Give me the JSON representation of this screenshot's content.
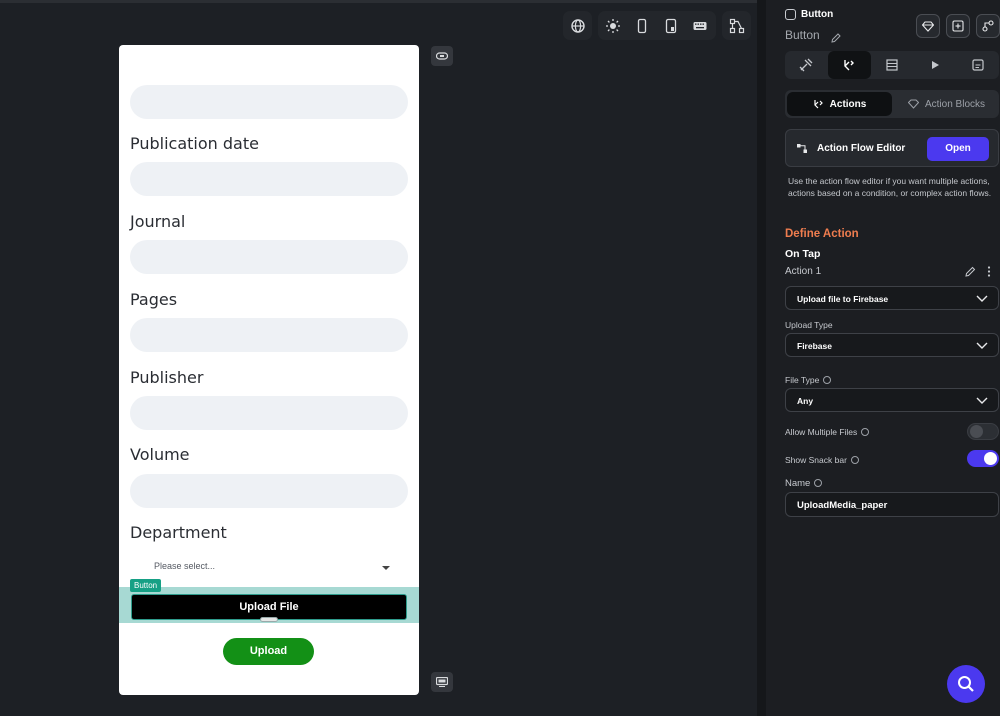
{
  "device": {
    "labels": [
      "Publication date",
      "Journal",
      "Pages",
      "Publisher",
      "Volume",
      "Department"
    ],
    "dropdown_placeholder": "Please select...",
    "selection_tag": "Button",
    "upload_file_label": "Upload File",
    "upload_label": "Upload"
  },
  "toolbar": {
    "icons": [
      "globe-icon",
      "sun-icon",
      "phone-icon",
      "tablet-icon",
      "keyboard-icon",
      "tree-icon"
    ]
  },
  "panel": {
    "widget_type": "Button",
    "widget_name": "Button",
    "segments": {
      "actions": "Actions",
      "action_blocks": "Action Blocks"
    },
    "afe_title": "Action Flow Editor",
    "open_label": "Open",
    "help_text": "Use the action flow editor if you want multiple actions, actions based on a condition, or complex action flows.",
    "define_action": "Define Action",
    "on_tap": "On Tap",
    "action1": "Action 1",
    "action_select": "Upload file to Firebase",
    "upload_type_label": "Upload Type",
    "upload_type_value": "Firebase",
    "file_type_label": "File Type",
    "file_type_value": "Any",
    "allow_multiple_label": "Allow Multiple Files",
    "allow_multiple_on": false,
    "show_snackbar_label": "Show Snack bar",
    "show_snackbar_on": true,
    "name_label": "Name",
    "name_value": "UploadMedia_paper"
  },
  "colors": {
    "accent": "#4b39ef",
    "define_action": "#ef7d4f",
    "upload_green": "#139016",
    "selection": "#a7d9d3"
  }
}
